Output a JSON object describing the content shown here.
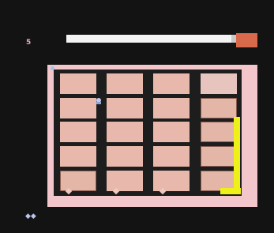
{
  "hud": {
    "level": "5",
    "progress": 0.96,
    "lives": "",
    "score": ""
  },
  "grid": {
    "rows": 5,
    "cols": 4,
    "highlighted_cells": [
      [
        4,
        0
      ],
      [
        1,
        3
      ],
      [
        2,
        3
      ],
      [
        3,
        3
      ],
      [
        4,
        3
      ]
    ]
  },
  "colors": {
    "board_border": "#f2c6cb",
    "cell": "#e9b8ac",
    "side_bar": "#eef01a",
    "progress_end": "#d8694a",
    "hud_text": "#b8c6ee"
  },
  "icons": {
    "player": "player-icon",
    "marker": "diamond-marker-icon",
    "lives": "lives-icon"
  }
}
